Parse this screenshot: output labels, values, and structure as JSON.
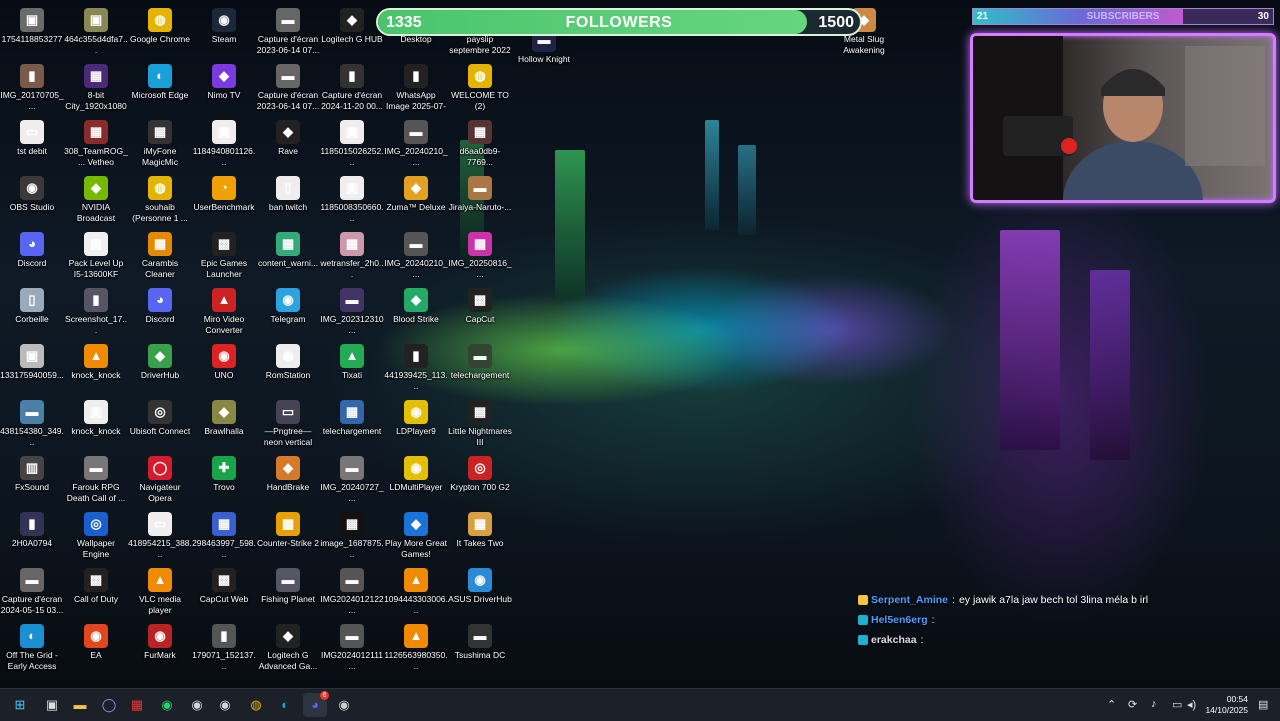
{
  "desktop": {
    "icons": [
      {
        "label": "1754118853277",
        "glyph": "▣",
        "color": "#6a6a6a"
      },
      {
        "label": "IMG_20170705_...",
        "glyph": "▮",
        "color": "#7a5a4a"
      },
      {
        "label": "tst debit",
        "glyph": "▭",
        "color": "#eeeeee"
      },
      {
        "label": "OBS Studio",
        "glyph": "◉",
        "color": "#3a3a3a"
      },
      {
        "label": "Discord",
        "glyph": "◕",
        "color": "#5865f2"
      },
      {
        "label": "Corbeille",
        "glyph": "▯",
        "color": "#9ab"
      },
      {
        "label": "133175940059...",
        "glyph": "▣",
        "color": "#bbb"
      },
      {
        "label": "438154380_349...",
        "glyph": "▬",
        "color": "#4a7fa8"
      },
      {
        "label": "FxSound",
        "glyph": "▥",
        "color": "#444"
      },
      {
        "label": "2H0A0794",
        "glyph": "▮",
        "color": "#335"
      },
      {
        "label": "Capture d'écran 2024-05-15 03...",
        "glyph": "▬",
        "color": "#666"
      },
      {
        "label": "Off The Grid - Early Access",
        "glyph": "◐",
        "color": "#1a8fd1"
      },
      {
        "label": "464c355d4dfa7...",
        "glyph": "▣",
        "color": "#885"
      },
      {
        "label": "8-bit City_1920x1080",
        "glyph": "▦",
        "color": "#4a2a7a"
      },
      {
        "label": "308_TeamROG_... Vetheo",
        "glyph": "▦",
        "color": "#8a2a2a"
      },
      {
        "label": "NVIDIA Broadcast",
        "glyph": "◆",
        "color": "#76b900"
      },
      {
        "label": "Pack Level Up I5-13600KF",
        "glyph": "▤",
        "color": "#f0f0f0"
      },
      {
        "label": "Screenshot_17...",
        "glyph": "▮",
        "color": "#556"
      },
      {
        "label": "knock_knock",
        "glyph": "▲",
        "color": "#f08a00"
      },
      {
        "label": "knock_knock",
        "glyph": "▣",
        "color": "#eee"
      },
      {
        "label": "Farouk RPG Death Call of ...",
        "glyph": "▬",
        "color": "#777"
      },
      {
        "label": "Wallpaper Engine",
        "glyph": "◎",
        "color": "#1a5fd0"
      },
      {
        "label": "Call of Duty",
        "glyph": "▩",
        "color": "#222"
      },
      {
        "label": "EA",
        "glyph": "◉",
        "color": "#e2461f"
      },
      {
        "label": "Google Chrome",
        "glyph": "◍",
        "color": "#e5b400"
      },
      {
        "label": "Microsoft Edge",
        "glyph": "◐",
        "color": "#1aa0d8"
      },
      {
        "label": "iMyFone MagicMic",
        "glyph": "▦",
        "color": "#333"
      },
      {
        "label": "souhaib (Personne 1 ...",
        "glyph": "◍",
        "color": "#e5b400"
      },
      {
        "label": "Carambis Cleaner",
        "glyph": "▦",
        "color": "#e58a00"
      },
      {
        "label": "Discord",
        "glyph": "◕",
        "color": "#5865f2"
      },
      {
        "label": "DriverHub",
        "glyph": "◆",
        "color": "#3aa14a"
      },
      {
        "label": "Ubisoft Connect",
        "glyph": "◎",
        "color": "#333"
      },
      {
        "label": "Navigateur Opera",
        "glyph": "◯",
        "color": "#d81b2c"
      },
      {
        "label": "418954215_388...",
        "glyph": "▭",
        "color": "#eee"
      },
      {
        "label": "VLC media player",
        "glyph": "▲",
        "color": "#f08a00"
      },
      {
        "label": "FurMark",
        "glyph": "◉",
        "color": "#b22"
      },
      {
        "label": "Steam",
        "glyph": "◉",
        "color": "#1b2838"
      },
      {
        "label": "Nimo TV",
        "glyph": "◆",
        "color": "#7a3ae0"
      },
      {
        "label": "1184940801126...",
        "glyph": "▣",
        "color": "#eee"
      },
      {
        "label": "UserBenchmark",
        "glyph": "◔",
        "color": "#f0a000"
      },
      {
        "label": "Epic Games Launcher",
        "glyph": "▩",
        "color": "#222"
      },
      {
        "label": "Miro Video Converter",
        "glyph": "▲",
        "color": "#c22"
      },
      {
        "label": "UNO",
        "glyph": "◉",
        "color": "#d22"
      },
      {
        "label": "Brawlhalla",
        "glyph": "◆",
        "color": "#884"
      },
      {
        "label": "Trovo",
        "glyph": "✚",
        "color": "#1aa34a"
      },
      {
        "label": "298463997_598...",
        "glyph": "▦",
        "color": "#3a5fd0"
      },
      {
        "label": "CapCut Web",
        "glyph": "▩",
        "color": "#222"
      },
      {
        "label": "179071_152137...",
        "glyph": "▮",
        "color": "#555"
      },
      {
        "label": "Capture d'écran 2023-06-14 07...",
        "glyph": "▬",
        "color": "#666"
      },
      {
        "label": "Capture d'écran 2023-06-14 07...",
        "glyph": "▬",
        "color": "#666"
      },
      {
        "label": "Rave",
        "glyph": "◆",
        "color": "#222"
      },
      {
        "label": "ban twitch",
        "glyph": "▯",
        "color": "#eee"
      },
      {
        "label": "content_warni...",
        "glyph": "▦",
        "color": "#3a7"
      },
      {
        "label": "Telegram",
        "glyph": "◉",
        "color": "#2aa3de"
      },
      {
        "label": "RomStation",
        "glyph": "◉",
        "color": "#eee"
      },
      {
        "label": "—Pngtree—neon vertical frame d...",
        "glyph": "▭",
        "color": "#445"
      },
      {
        "label": "HandBrake",
        "glyph": "◆",
        "color": "#d67a2a"
      },
      {
        "label": "Counter-Strike 2",
        "glyph": "▩",
        "color": "#e6a000"
      },
      {
        "label": "Fishing Planet",
        "glyph": "▬",
        "color": "#556"
      },
      {
        "label": "Logitech G Advanced Ga...",
        "glyph": "◆",
        "color": "#222"
      },
      {
        "label": "Logitech G HUB",
        "glyph": "◆",
        "color": "#222"
      },
      {
        "label": "Capture d'écran 2024-11-20 00...",
        "glyph": "▮",
        "color": "#333"
      },
      {
        "label": "1185015026252...",
        "glyph": "▣",
        "color": "#eee"
      },
      {
        "label": "1185008350660...",
        "glyph": "▣",
        "color": "#eee"
      },
      {
        "label": "wetransfer_2h0...",
        "glyph": "▦",
        "color": "#c9a"
      },
      {
        "label": "IMG_202312310...",
        "glyph": "▬",
        "color": "#436"
      },
      {
        "label": "Tixati",
        "glyph": "▲",
        "color": "#2a5"
      },
      {
        "label": "telechargement",
        "glyph": "▦",
        "color": "#36a"
      },
      {
        "label": "IMG_20240727_...",
        "glyph": "▬",
        "color": "#777"
      },
      {
        "label": "image_1687875...",
        "glyph": "▦",
        "color": "#111"
      },
      {
        "label": "IMG2024012122...",
        "glyph": "▬",
        "color": "#555"
      },
      {
        "label": "IMG2024012111...",
        "glyph": "▬",
        "color": "#555"
      },
      {
        "label": "Desktop",
        "glyph": "▭",
        "color": "#eee"
      },
      {
        "label": "WhatsApp Image 2025-07-27 à 23...",
        "glyph": "▮",
        "color": "#222"
      },
      {
        "label": "IMG_20240210_...",
        "glyph": "▬",
        "color": "#555"
      },
      {
        "label": "Zuma™ Deluxe",
        "glyph": "◆",
        "color": "#e4a020"
      },
      {
        "label": "IMG_20240210_...",
        "glyph": "▬",
        "color": "#555"
      },
      {
        "label": "Blood Strike",
        "glyph": "◆",
        "color": "#2a6"
      },
      {
        "label": "441939425_113...",
        "glyph": "▮",
        "color": "#222"
      },
      {
        "label": "LDPlayer9",
        "glyph": "◉",
        "color": "#e4c000"
      },
      {
        "label": "LDMultiPlayer",
        "glyph": "◉",
        "color": "#e4c000"
      },
      {
        "label": "Play More Great Games!",
        "glyph": "◆",
        "color": "#1a73d8"
      },
      {
        "label": "1094443303006...",
        "glyph": "▲",
        "color": "#f08a00"
      },
      {
        "label": "1126563980350...",
        "glyph": "▲",
        "color": "#f08a00"
      },
      {
        "label": "payslip septembre 2022",
        "glyph": "◍",
        "color": "#e5b400"
      },
      {
        "label": "WELCOME TO (2)",
        "glyph": "◍",
        "color": "#e5b400"
      },
      {
        "label": "d6aa0db9-7769...",
        "glyph": "▦",
        "color": "#533"
      },
      {
        "label": "Jiraiya-Naruto-...",
        "glyph": "▬",
        "color": "#a74"
      },
      {
        "label": "IMG_20250816_...",
        "glyph": "▦",
        "color": "#c3a"
      },
      {
        "label": "CapCut",
        "glyph": "▩",
        "color": "#222"
      },
      {
        "label": "telechargement",
        "glyph": "▬",
        "color": "#343"
      },
      {
        "label": "Little Nightmares III",
        "glyph": "▦",
        "color": "#222"
      },
      {
        "label": "Krypton 700 G2",
        "glyph": "◎",
        "color": "#c22"
      },
      {
        "label": "It Takes Two",
        "glyph": "▦",
        "color": "#d9a040"
      },
      {
        "label": "ASUS DriverHub",
        "glyph": "◉",
        "color": "#2a8cd8"
      },
      {
        "label": "Tsushima DC",
        "glyph": "▬",
        "color": "#333"
      },
      {
        "label": "Hollow Knight",
        "glyph": "▬",
        "color": "#224"
      },
      {
        "label": "Metal Slug Awakening",
        "glyph": "◆",
        "color": "#c84"
      }
    ]
  },
  "followers_goal": {
    "current": "1335",
    "title": "FOLLOWERS",
    "goal": "1500",
    "progress": 0.89
  },
  "subscribers_goal": {
    "current": "21",
    "title": "SUBSCRIBERS",
    "goal": "30",
    "progress": 0.7
  },
  "chat": [
    {
      "user": "Serpent_Amine",
      "separator": ":",
      "message": "ey jawik a7la jaw bech tol 3lina méla b irl",
      "user_color": "#4f9bff"
    },
    {
      "user": "Hel5en6erg",
      "separator": ":",
      "message": "",
      "user_color": "#4f9bff"
    },
    {
      "user": "erakchaa",
      "separator": ":",
      "message": "",
      "user_color": "#dddddd"
    }
  ],
  "taskbar": {
    "apps": [
      "start-icon",
      "task-view-icon",
      "file-explorer-icon",
      "cortana-icon",
      "snipping-tool-icon",
      "whatsapp-icon",
      "steam-icon",
      "steam-icon",
      "chrome-icon",
      "edge-icon",
      "discord-icon",
      "obs-icon"
    ],
    "discord_badge": "6",
    "clock_time": "00:54",
    "clock_date": "14/10/2025"
  }
}
